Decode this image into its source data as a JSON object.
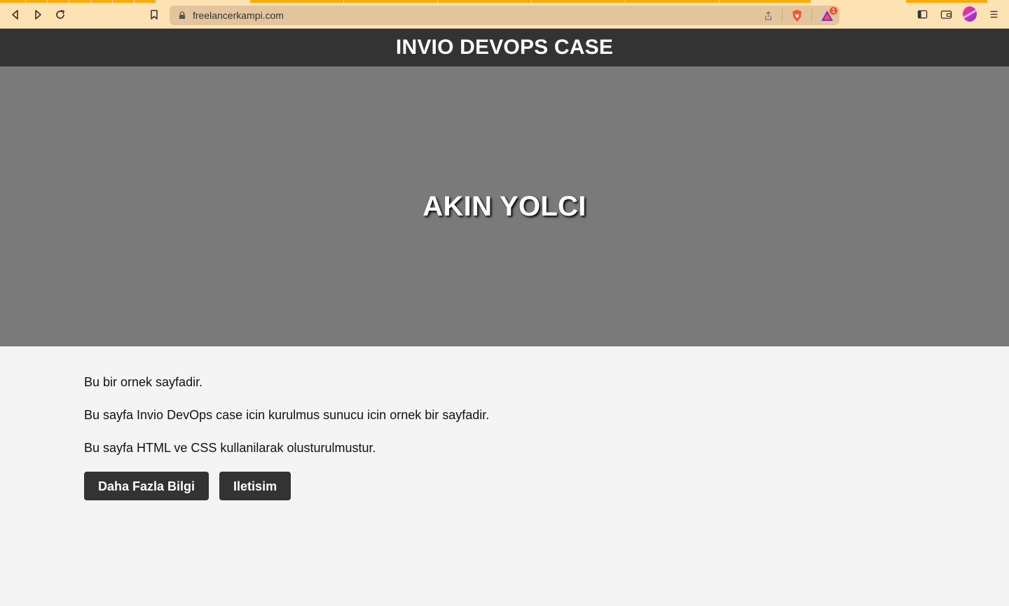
{
  "browser": {
    "url": "freelancerkampi.com",
    "icons": [
      "back-icon",
      "forward-icon",
      "reload-icon",
      "bookmark-icon",
      "lock-icon",
      "share-icon",
      "brave-shield-icon",
      "brave-rewards-icon",
      "sidebar-icon",
      "wallet-icon",
      "profile-avatar",
      "menu-icon"
    ],
    "rewards_badge": "1",
    "accent_color": "#ffab00"
  },
  "header": {
    "title": "INVIO DEVOPS CASE"
  },
  "hero": {
    "name": "AKIN YOLCI"
  },
  "main": {
    "paragraphs": [
      "Bu bir ornek sayfadir.",
      "Bu sayfa Invio DevOps case icin kurulmus sunucu icin ornek bir sayfadir.",
      "Bu sayfa HTML ve CSS kullanilarak olusturulmustur."
    ],
    "buttons": {
      "more_info": "Daha Fazla Bilgi",
      "contact": "Iletisim"
    }
  },
  "colors": {
    "header_bg": "#333333",
    "hero_bg": "#7a7a7a",
    "page_bg": "#f4f4f4",
    "button_bg": "#333333"
  }
}
